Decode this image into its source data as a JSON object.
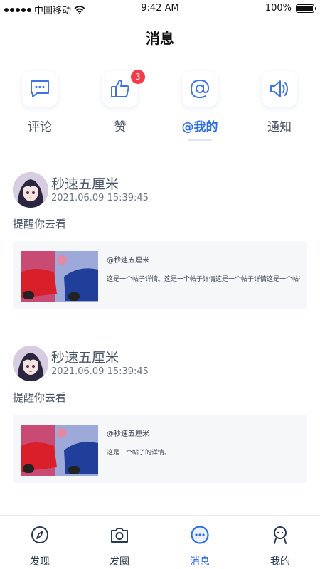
{
  "status_bar": {
    "carrier": "中国移动",
    "time": "9:42 AM",
    "battery": "100%",
    "battery_level": 1.0
  },
  "header": {
    "title": "消息"
  },
  "tabs": [
    {
      "label": "评论",
      "icon": "comment-icon",
      "active": false,
      "badge": ""
    },
    {
      "label": "赞",
      "icon": "thumbs-up-icon",
      "active": false,
      "badge": "3"
    },
    {
      "label": "@我的",
      "icon": "at-icon",
      "active": true,
      "badge": ""
    },
    {
      "label": "通知",
      "icon": "speaker-icon",
      "active": false,
      "badge": ""
    }
  ],
  "messages": [
    {
      "user": "秒速五厘米",
      "time": "2021.06.09   15:39:45",
      "text": "提醒你去看",
      "post": {
        "author": "@秒速五厘米",
        "content": "这是一个帖子详情。这是一个帖子详情这是一个帖子详情这是一个帖子详......"
      }
    },
    {
      "user": "秒速五厘米",
      "time": "2021.06.09   15:39:45",
      "text": "提醒你去看",
      "post": {
        "author": "@秒速五厘米",
        "content": "这是一个帖子的详情。"
      }
    }
  ],
  "bottom_nav": [
    {
      "label": "发现",
      "icon": "compass-icon",
      "active": false
    },
    {
      "label": "发圈",
      "icon": "camera-icon",
      "active": false
    },
    {
      "label": "消息",
      "icon": "message-icon",
      "active": true
    },
    {
      "label": "我的",
      "icon": "profile-icon",
      "active": false
    }
  ],
  "colors": {
    "accent": "#2f6ee0",
    "badge": "#f23d46",
    "text": "#4a5566",
    "card_bg": "#f6f7f9"
  }
}
